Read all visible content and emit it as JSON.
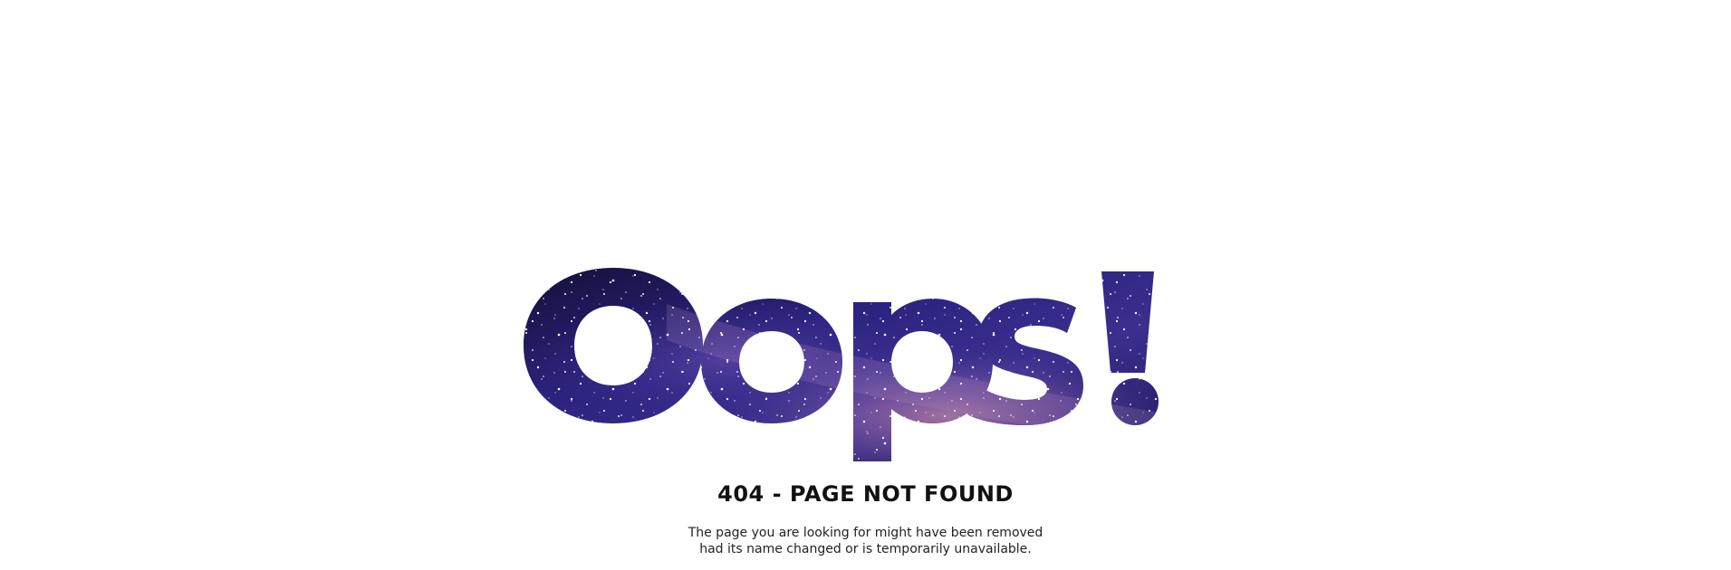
{
  "page": {
    "headline": "Oops!",
    "error_title": "404 - PAGE NOT FOUND",
    "message_line1": "The page you are looking for might have been removed",
    "message_line2": "had its name changed or is temporarily unavailable."
  },
  "colors": {
    "background": "#ffffff",
    "space_dark": "#14103a",
    "space_mid": "#3a2f8f",
    "space_light": "#6a4fb0",
    "nebula_pink": "#c58aa8",
    "text": "#111111"
  }
}
